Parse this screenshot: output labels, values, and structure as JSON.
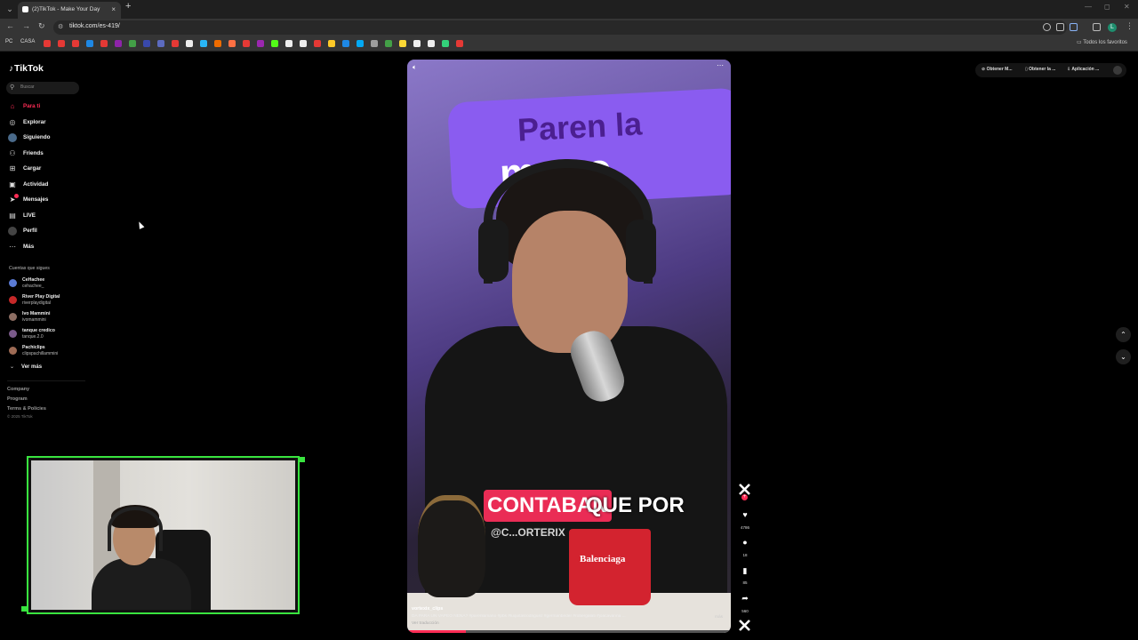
{
  "browser": {
    "tab_title": "(2)TikTok - Make Your Day",
    "tab_close": "×",
    "new_tab": "+",
    "url": "tiktok.com/es-419/",
    "window_controls": [
      "—",
      "◻",
      "✕"
    ],
    "bookmarks": {
      "pc_label": "PC",
      "casa_label": "CASA",
      "favorites_label": "Todos los favoritos",
      "icon_colors": [
        "#e53935",
        "#e53935",
        "#e53935",
        "#1e88e5",
        "#e53935",
        "#8e24aa",
        "#43a047",
        "#3949ab",
        "#5c6bc0",
        "#e53935",
        "#eeeeee",
        "#29b6f6",
        "#ef6c00",
        "#ff7043",
        "#e53935",
        "#9c27b0",
        "#53fc18",
        "#eeeeee",
        "#eeeeee",
        "#e53935",
        "#ffca28",
        "#1e88e5",
        "#03a9f4",
        "#9e9e9e",
        "#43a047",
        "#fdd835",
        "#eeeeee",
        "#eeeeee",
        "#33d17a",
        "#e53935"
      ]
    }
  },
  "sidebar": {
    "logo": "TikTok",
    "search_placeholder": "Buscar",
    "nav": [
      {
        "label": "Para ti",
        "icon": "home-icon",
        "glyph": "⌂",
        "active": true
      },
      {
        "label": "Explorar",
        "icon": "compass-icon",
        "glyph": "◎"
      },
      {
        "label": "Siguiendo",
        "icon": "following-icon",
        "glyph": "●"
      },
      {
        "label": "Friends",
        "icon": "friends-icon",
        "glyph": "⚇"
      },
      {
        "label": "Cargar",
        "icon": "upload-icon",
        "glyph": "⊞"
      },
      {
        "label": "Actividad",
        "icon": "activity-icon",
        "glyph": "▣"
      },
      {
        "label": "Mensajes",
        "icon": "messages-icon",
        "glyph": "➤"
      },
      {
        "label": "LIVE",
        "icon": "live-icon",
        "glyph": "▤"
      },
      {
        "label": "Perfil",
        "icon": "profile-icon",
        "glyph": "●"
      },
      {
        "label": "Más",
        "icon": "more-icon",
        "glyph": "⋯"
      }
    ],
    "following_title": "Cuentas que sigues",
    "accounts": [
      {
        "name": "CeHachee",
        "handle": "cehachee_"
      },
      {
        "name": "River Play Digital",
        "handle": "riverplaydigital"
      },
      {
        "name": "Ivo Mammini",
        "handle": "ivomammini"
      },
      {
        "name": "tanque credico",
        "handle": "tanque.2.0"
      },
      {
        "name": "Pachiclips",
        "handle": "clipspachillammini"
      }
    ],
    "ver_mas": "Ver más",
    "footer": [
      "Company",
      "Program",
      "Terms & Policies"
    ],
    "copyright": "© 2025 TikTok"
  },
  "video": {
    "banner_line1": "Paren la",
    "banner_line2": "mano",
    "caption_highlight": "CONTABAN",
    "caption_rest": "QUE POR",
    "watermark": "@C...ORTERIX",
    "mug_text": "Balenciaga",
    "author": "vortexix_clips",
    "description": "DA PARA UN VAPEO NENA? #parenlamano #pbs #luquitasrodriguez #germanbeder #robergalati #joacavanna ...",
    "more": "más",
    "translate": "Ver traducción",
    "progress_fraction": 0.18,
    "mute_glyph": "🔈︎",
    "more_glyph": "⋯"
  },
  "rail": {
    "likes": "4786",
    "comments": "18",
    "saves": "85",
    "shares": "560",
    "plus": "+",
    "like_glyph": "♥",
    "comment_glyph": "●",
    "save_glyph": "▮",
    "share_glyph": "➦"
  },
  "top_actions": {
    "obtener_m": "Obtener M...",
    "obtener_la": "Obtener la ...",
    "aplicacion": "Aplicación ..."
  },
  "scroll": {
    "up": "⌃",
    "down": "⌄"
  },
  "colors": {
    "accent": "#fe2c55",
    "cam_border": "#39e43f"
  }
}
